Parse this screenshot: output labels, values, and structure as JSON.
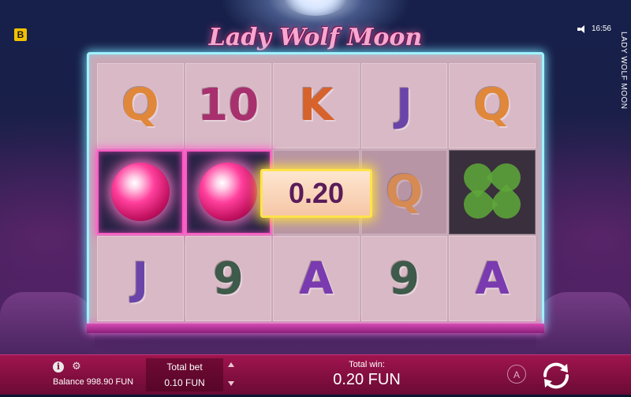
{
  "header": {
    "brand_badge": "B",
    "game_title": "Lady Wolf Moon",
    "clock": "16:56",
    "vertical_title": "LADY WOLF MOON"
  },
  "reels": {
    "rows": [
      [
        {
          "symbol": "Q",
          "color": "#e0873a"
        },
        {
          "symbol": "10",
          "color": "#a8306e"
        },
        {
          "symbol": "K",
          "color": "#d6622c"
        },
        {
          "symbol": "J",
          "color": "#6a44a8"
        },
        {
          "symbol": "Q",
          "color": "#e0873a"
        }
      ],
      [
        {
          "symbol": "orb",
          "color": "#ff3f9c"
        },
        {
          "symbol": "orb",
          "color": "#ff3f9c"
        },
        {
          "symbol": "",
          "color": ""
        },
        {
          "symbol": "Q",
          "color": "#e0873a"
        },
        {
          "symbol": "clover",
          "color": "#5ea83a"
        }
      ],
      [
        {
          "symbol": "J",
          "color": "#6a44a8"
        },
        {
          "symbol": "9",
          "color": "#3d5a4a"
        },
        {
          "symbol": "A",
          "color": "#7a3ab0"
        },
        {
          "symbol": "9",
          "color": "#3d5a4a"
        },
        {
          "symbol": "A",
          "color": "#7a3ab0"
        }
      ]
    ],
    "win_amount": "0.20"
  },
  "bottom_bar": {
    "balance": "Balance 998.90 FUN",
    "total_bet_label": "Total bet",
    "total_bet_value": "0.10 FUN",
    "total_win_label": "Total win:",
    "total_win_value": "0.20 FUN",
    "auto_label": "A"
  },
  "colors": {
    "frame_glow": "#9ff2ff",
    "win_glow": "#ffe34a",
    "bar": "#a0144e"
  }
}
